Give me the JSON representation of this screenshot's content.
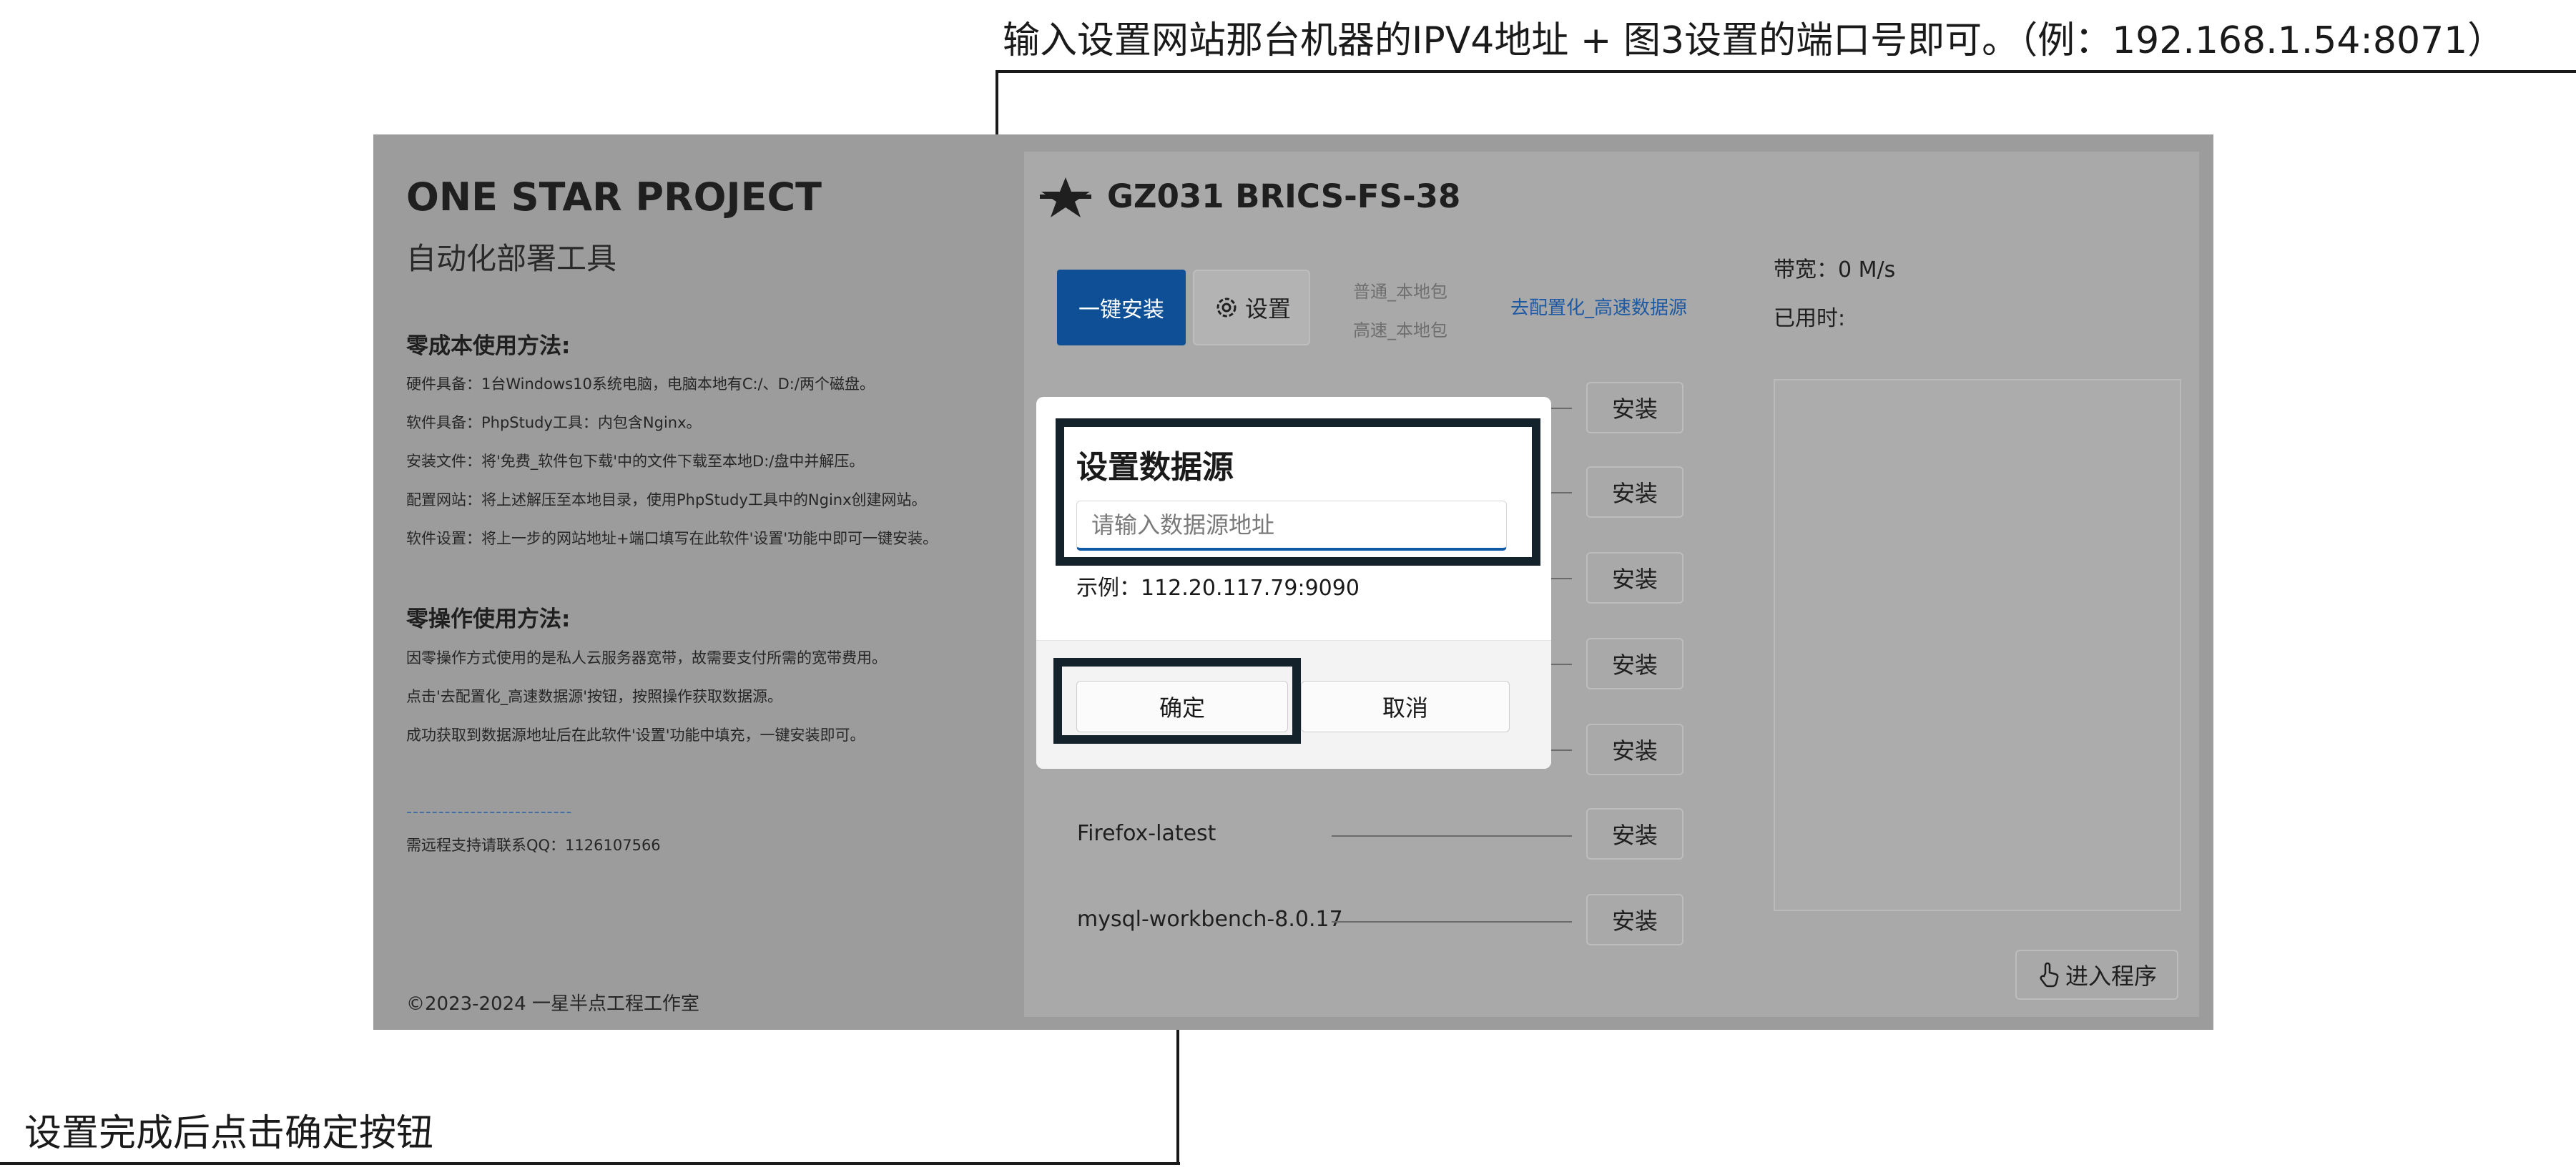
{
  "annotations": {
    "top_callout": "输入设置网站那台机器的IPV4地址 + 图3设置的端口号即可。（例：192.168.1.54:8071）",
    "bottom_callout": "设置完成后点击确定按钮"
  },
  "sidebar": {
    "title": "ONE STAR PROJECT",
    "subtitle": "自动化部署工具",
    "zero_cost": {
      "heading": "零成本使用方法:",
      "lines": [
        "硬件具备：1台Windows10系统电脑，电脑本地有C:/、D:/两个磁盘。",
        "软件具备：PhpStudy工具：内包含Nginx。",
        "安装文件：将'免费_软件包下载'中的文件下载至本地D:/盘中并解压。",
        "配置网站：将上述解压至本地目录，使用PhpStudy工具中的Nginx创建网站。",
        "软件设置：将上一步的网站地址+端口填写在此软件'设置'功能中即可一键安装。"
      ]
    },
    "zero_op": {
      "heading": "零操作使用方法:",
      "lines": [
        "因零操作方式使用的是私人云服务器宽带，故需要支付所需的宽带费用。",
        "点击'去配置化_高速数据源'按钮，按照操作获取数据源。",
        "成功获取到数据源地址后在此软件'设置'功能中填充，一键安装即可。"
      ]
    },
    "divider": "--------------------------",
    "contact": "需远程支持请联系QQ：1126107566",
    "copyright": "©2023-2024 一星半点工程工作室"
  },
  "main": {
    "project_name": "GZ031  BRICS-FS-38",
    "install_button": "一键安装",
    "settings_button": "设置",
    "package_normal": "普通_本地包",
    "package_fast": "高速_本地包",
    "fast_source_link": "去配置化_高速数据源",
    "bandwidth": "带宽：0 M/s",
    "elapsed": "已用时:",
    "enter_button": "进入程序",
    "rows": [
      {
        "label": "",
        "button": "安装"
      },
      {
        "label": "",
        "button": "安装"
      },
      {
        "label": "",
        "button": "安装"
      },
      {
        "label": "",
        "button": "安装"
      },
      {
        "label": "",
        "button": "安装"
      },
      {
        "label": "Firefox-latest",
        "button": "安装"
      },
      {
        "label": "mysql-workbench-8.0.17",
        "button": "安装"
      }
    ]
  },
  "dialog": {
    "title": "设置数据源",
    "input_placeholder": "请输入数据源地址",
    "example": "示例：112.20.117.79:9090",
    "confirm": "确定",
    "cancel": "取消"
  },
  "colors": {
    "primary": "#0e4f96",
    "link": "#1e5aa3",
    "highlight_border": "#14222b",
    "overlay": "#9c9c9c"
  }
}
